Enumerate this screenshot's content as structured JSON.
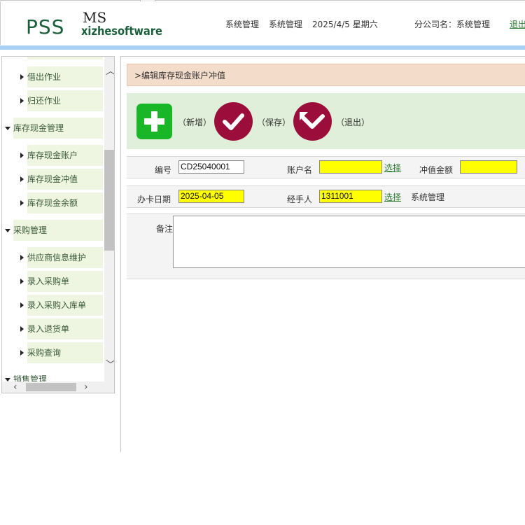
{
  "header": {
    "logo_pss": "PSS",
    "logo_ms": "MS",
    "logo_xizhe": "xizhesoftware",
    "menu1": "系统管理",
    "menu2": "系统管理",
    "date": "2025/4/5 星期六",
    "branch_label": "分公司名：",
    "branch_value": "系统管理",
    "logout": "退出"
  },
  "sidebar": {
    "sub_lend": "借出作业",
    "sub_return": "归还作业",
    "grp_cash": "库存现金管理",
    "sub_cash_account": "库存现金账户",
    "sub_cash_topup": "库存现金冲值",
    "sub_cash_balance": "库存现金余额",
    "grp_purchase": "采购管理",
    "sub_supplier": "供应商信息维护",
    "sub_po": "录入采购单",
    "sub_po_in": "录入采购入库单",
    "sub_po_return": "录入退货单",
    "sub_po_query": "采购查询",
    "grp_sales": "销售管理"
  },
  "breadcrumb": ">编辑库存现金账户冲值",
  "toolbar": {
    "add_label": "（新增）",
    "save_label": "（保存）",
    "exit_label": "（退出）"
  },
  "form": {
    "code_label": "编号",
    "code_value": "CD25040001",
    "account_label": "账户名",
    "account_value": "",
    "account_select": "选择",
    "amount_label": "冲值金额",
    "amount_value": "",
    "date_label": "办卡日期",
    "date_value": "2025-04-05",
    "handler_label": "经手人",
    "handler_value": "1311001",
    "handler_select": "选择",
    "handler_name": "系统管理",
    "note_label": "备注",
    "note_value": ""
  },
  "colors": {
    "accent_green": "#19b728",
    "button_maroon": "#9b0e3b",
    "required_yellow": "#ffff00",
    "header_blue_bar": "#a7d0f2"
  }
}
